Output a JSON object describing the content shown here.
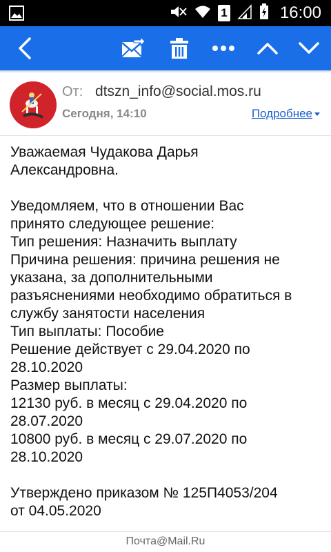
{
  "status_bar": {
    "time": "16:00",
    "icons": [
      "image-icon",
      "mute-icon",
      "wifi-icon",
      "sim-icon",
      "signal-icon",
      "battery-icon"
    ],
    "sim_number": "1"
  },
  "toolbar": {
    "color": "#1a6ee8",
    "icons": [
      "back-icon",
      "move-mail-icon",
      "trash-icon",
      "more-icon",
      "chevron-up-icon",
      "chevron-down-icon"
    ]
  },
  "header": {
    "from_label": "От:",
    "from_email": "dtszn_info@social.mos.ru",
    "date": "Сегодня, 14:10",
    "details_link": "Подробнее"
  },
  "body": {
    "lines": [
      "Уважаемая Чудакова Дарья",
      "Александровна.",
      "",
      "Уведомляем, что в отношении Вас",
      "принято следующее решение:",
      "Тип решения: Назначить выплату",
      "Причина решения: причина решения не",
      "указана, за дополнительными",
      "разъяснениями необходимо обратиться в",
      "службу занятости населения",
      "Тип выплаты: Пособие",
      "Решение действует с 29.04.2020 по",
      "28.10.2020",
      "Размер выплаты:",
      "12130 руб. в месяц с 29.04.2020 по",
      "28.07.2020",
      "10800 руб. в месяц с 29.07.2020 по",
      "28.10.2020",
      "",
      "Утверждено приказом № 125П4053/204",
      "от 04.05.2020"
    ]
  },
  "footer": {
    "text": "Почта@Mail.Ru"
  }
}
